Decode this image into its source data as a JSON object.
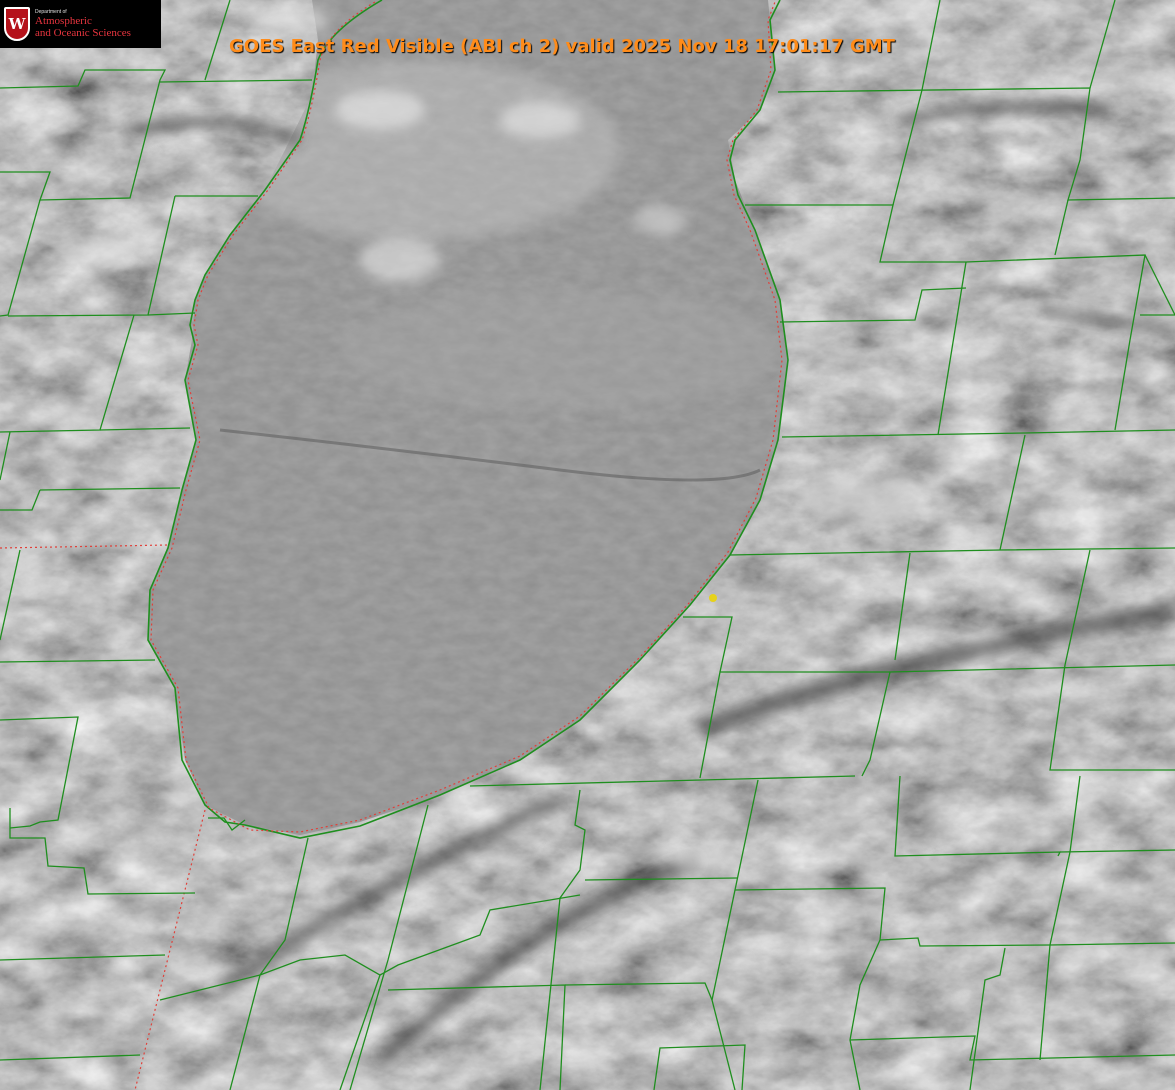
{
  "header": {
    "title": "GOES East Red Visible (ABI ch 2) valid 2025 Nov 18 17:01:17 GMT"
  },
  "logo": {
    "seal_letter": "W",
    "dept_line": "Department of",
    "line1": "Atmospheric",
    "line2": "and Oceanic Sciences"
  },
  "map": {
    "product": "GOES East Red Visible",
    "channel": "ABI ch 2",
    "imagery": "grayscale satellite cloud imagery",
    "county_border_color": "#1f8f1f",
    "lake_outline_color": "#1f8f1f",
    "state_border_color": "#e0403a",
    "marker_color": "#e6d21a",
    "title_color": "#ff8c1a"
  }
}
